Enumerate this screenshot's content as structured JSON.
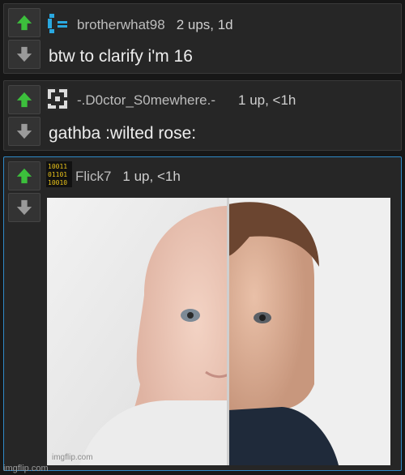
{
  "colors": {
    "upvote": "#3cbf3c",
    "downvote": "#9a9a9a",
    "accent": "#2f8ac7"
  },
  "comments": [
    {
      "username": "brotherwhat98",
      "stats": "2 ups, 1d",
      "text": "btw to clarify i'm 16",
      "avatar_icon": "bracket-logo-icon"
    },
    {
      "username": "-.D0ctor_S0mewhere.-",
      "stats": "1 up, <1h",
      "text": "gathba :wilted rose:",
      "avatar_icon": "pixel-square-logo-icon"
    },
    {
      "username": "Flick7",
      "stats": "1 up, <1h",
      "image_alt": "baby face split half light half dark",
      "image_watermark": "imgflip.com",
      "avatar_icon": "binary-digits-icon",
      "avatar_text": "10011\n01101\n10010"
    }
  ],
  "footer": {
    "watermark": "imgflip.com"
  }
}
